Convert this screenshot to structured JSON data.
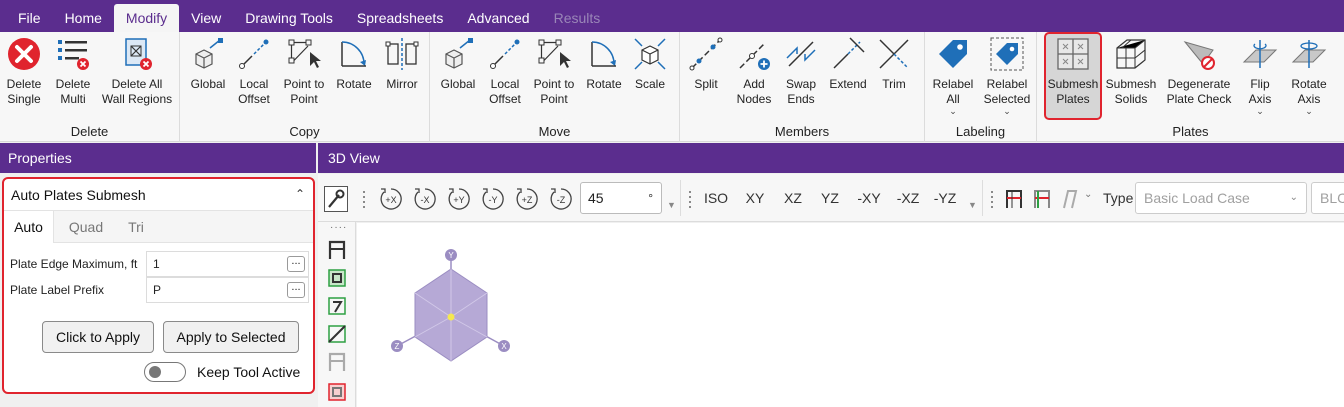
{
  "menu": {
    "tabs": [
      {
        "label": "File"
      },
      {
        "label": "Home"
      },
      {
        "label": "Modify"
      },
      {
        "label": "View"
      },
      {
        "label": "Drawing Tools"
      },
      {
        "label": "Spreadsheets"
      },
      {
        "label": "Advanced"
      },
      {
        "label": "Results"
      }
    ],
    "active": "Modify",
    "disabled": "Results"
  },
  "ribbon": {
    "groups": {
      "delete": "Delete",
      "copy": "Copy",
      "move": "Move",
      "members": "Members",
      "labeling": "Labeling",
      "plates": "Plates"
    },
    "buttons": {
      "delete_single": "Delete\nSingle",
      "delete_multi": "Delete\nMulti",
      "delete_all_wall": "Delete All\nWall Regions",
      "copy_global": "Global",
      "copy_local": "Local\nOffset",
      "copy_p2p": "Point to\nPoint",
      "copy_rotate": "Rotate",
      "copy_mirror": "Mirror",
      "move_global": "Global",
      "move_local": "Local\nOffset",
      "move_p2p": "Point to\nPoint",
      "move_rotate": "Rotate",
      "move_scale": "Scale",
      "split": "Split",
      "add_nodes": "Add\nNodes",
      "swap_ends": "Swap\nEnds",
      "extend": "Extend",
      "trim": "Trim",
      "relabel_all": "Relabel\nAll",
      "relabel_selected": "Relabel\nSelected",
      "submesh_plates": "Submesh\nPlates",
      "submesh_solids": "Submesh\nSolids",
      "degenerate": "Degenerate\nPlate Check",
      "flip_axis": "Flip\nAxis",
      "rotate_axis": "Rotate\nAxis"
    }
  },
  "properties": {
    "header": "Properties",
    "section_title": "Auto Plates Submesh",
    "tabs": [
      "Auto",
      "Quad",
      "Tri"
    ],
    "fields": [
      {
        "label": "Plate Edge Maximum, ft",
        "value": "1"
      },
      {
        "label": "Plate Label Prefix",
        "value": "P"
      }
    ],
    "dots": "...",
    "click_to_apply": "Click to Apply",
    "apply_to_selected": "Apply to Selected",
    "keep_tool_active": "Keep Tool Active"
  },
  "view": {
    "header": "3D View",
    "rotations": [
      "+X",
      "-X",
      "+Y",
      "-Y",
      "+Z",
      "-Z"
    ],
    "angle": "45",
    "angle_unit": "°",
    "views": [
      "ISO",
      "XY",
      "XZ",
      "YZ",
      "-XY",
      "-XZ",
      "-YZ"
    ],
    "type_label": "Type",
    "type_value": "Basic Load Case",
    "blc_value": "BLC",
    "gizmo": {
      "y": "Y",
      "z": "Z",
      "x": "X"
    }
  },
  "colors": {
    "brand": "#5b2d8e",
    "highlight": "#e0242e",
    "icon_blue": "#1f6fb8"
  }
}
